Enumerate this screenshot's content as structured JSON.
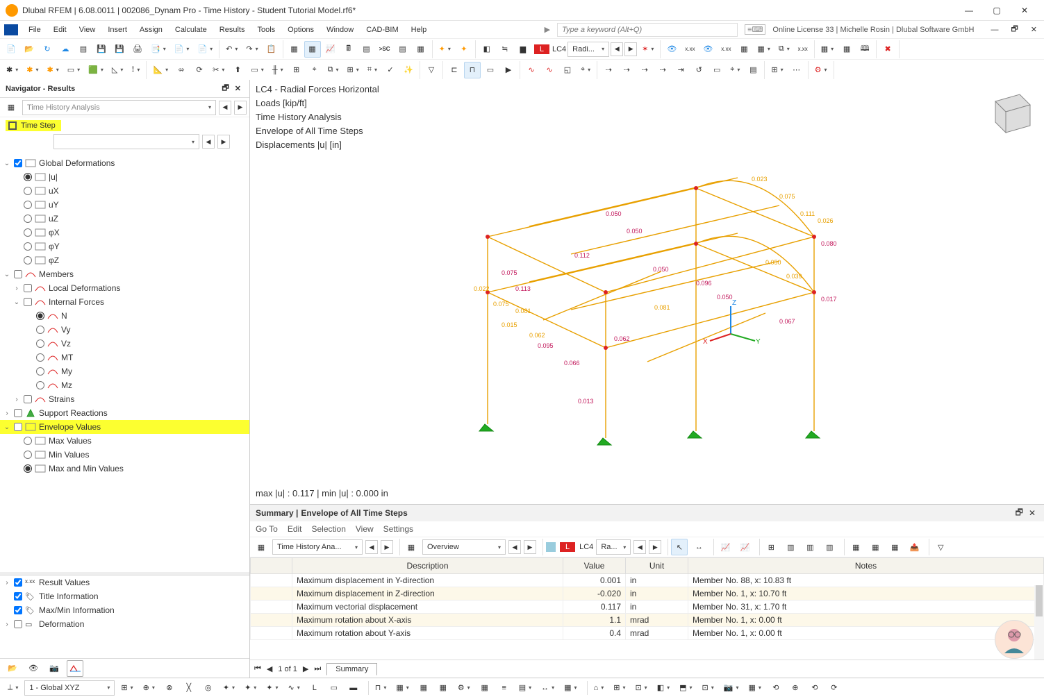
{
  "window": {
    "title": "Dlubal RFEM | 6.08.0011 | 002086_Dynam Pro - Time History - Student Tutorial Model.rf6*",
    "search_placeholder": "Type a keyword (Alt+Q)",
    "license": "Online License 33 | Michelle Rosin | Dlubal Software GmbH"
  },
  "menu": {
    "items": [
      "File",
      "Edit",
      "View",
      "Insert",
      "Assign",
      "Calculate",
      "Results",
      "Tools",
      "Options",
      "Window",
      "CAD-BIM",
      "Help"
    ]
  },
  "nav": {
    "title": "Navigator - Results",
    "analysis_combo": "Time History Analysis",
    "timestep_label": "Time Step",
    "tree": {
      "global_def": "Global Deformations",
      "u": "|u|",
      "ux": "uX",
      "uy": "uY",
      "uz": "uZ",
      "phix": "φX",
      "phiy": "φY",
      "phiz": "φZ",
      "members": "Members",
      "local_def": "Local Deformations",
      "internal_forces": "Internal Forces",
      "n": "N",
      "vy": "Vy",
      "vz": "Vz",
      "mt": "MT",
      "my": "My",
      "mz": "Mz",
      "strains": "Strains",
      "support": "Support Reactions",
      "envelope": "Envelope Values",
      "maxv": "Max Values",
      "minv": "Min Values",
      "maxmin": "Max and Min Values"
    },
    "bottom": {
      "result_values": "Result Values",
      "title_info": "Title Information",
      "maxmin_info": "Max/Min Information",
      "deformation": "Deformation"
    }
  },
  "viewport": {
    "lines": [
      "LC4 - Radial Forces Horizontal",
      "Loads [kip/ft]",
      "Time History Analysis",
      "Envelope of All Time Steps",
      "Displacements |u| [in]"
    ],
    "maxmin": "max |u| : 0.117 | min |u| : 0.000 in"
  },
  "summary": {
    "title_prefix": "Summary | ",
    "title_main": "Envelope of All Time Steps",
    "menu": [
      "Go To",
      "Edit",
      "Selection",
      "View",
      "Settings"
    ],
    "tb_combo1": "Time History Ana...",
    "tb_combo2": "Overview",
    "lc": "LC4",
    "radi": "Ra...",
    "table": {
      "cols": [
        "",
        "Description",
        "Value",
        "Unit",
        "Notes"
      ],
      "rows": [
        [
          "",
          "Maximum displacement in Y-direction",
          "0.001",
          "in",
          "Member No. 88, x: 10.83 ft"
        ],
        [
          "",
          "Maximum displacement in Z-direction",
          "-0.020",
          "in",
          "Member No. 1, x: 10.70 ft"
        ],
        [
          "",
          "Maximum vectorial displacement",
          "0.117",
          "in",
          "Member No. 31, x: 1.70 ft"
        ],
        [
          "",
          "Maximum rotation about X-axis",
          "1.1",
          "mrad",
          "Member No. 1, x: 0.00 ft"
        ],
        [
          "",
          "Maximum rotation about Y-axis",
          "0.4",
          "mrad",
          "Member No. 1, x: 0.00 ft"
        ]
      ]
    },
    "page_label": "1 of 1",
    "tab": "Summary"
  },
  "status": {
    "coord": "1 - Global XYZ"
  },
  "tb1_lc": "LC4",
  "tb1_radi": "Radi..."
}
